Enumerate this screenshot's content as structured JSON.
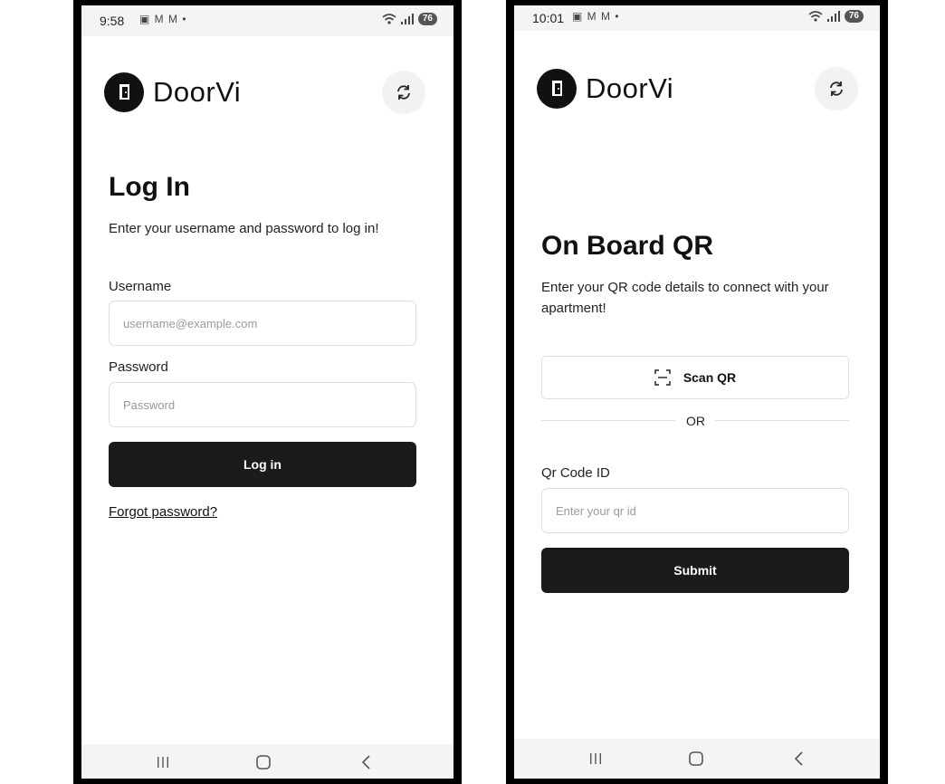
{
  "left_screen": {
    "status_time": "9:58",
    "status_icons": "▣ M M •",
    "battery": "76",
    "logo_text": "DoorVi",
    "title": "Log In",
    "subtitle": "Enter your username and password to log in!",
    "username_label": "Username",
    "username_placeholder": "username@example.com",
    "password_label": "Password",
    "password_placeholder": "Password",
    "login_button": "Log in",
    "forgot_link": "Forgot password?"
  },
  "right_screen": {
    "status_time": "10:01",
    "status_icons": "▣ M M •",
    "battery": "76",
    "logo_text": "DoorVi",
    "title": "On Board QR",
    "subtitle": "Enter your QR code details to connect with your apartment!",
    "scan_button": "Scan QR",
    "or_text": "OR",
    "qr_label": "Qr Code ID",
    "qr_placeholder": "Enter your qr id",
    "submit_button": "Submit"
  },
  "icons": {
    "refresh": "refresh-icon",
    "scan": "scan-qr-icon",
    "nav_recents": "recents-icon",
    "nav_home": "home-icon",
    "nav_back": "back-icon",
    "wifi": "wifi-icon",
    "signal": "signal-icon"
  },
  "colors": {
    "primary_button": "#1b1b1b",
    "input_border": "#dedede",
    "refresh_bg": "#f2f2f2"
  }
}
